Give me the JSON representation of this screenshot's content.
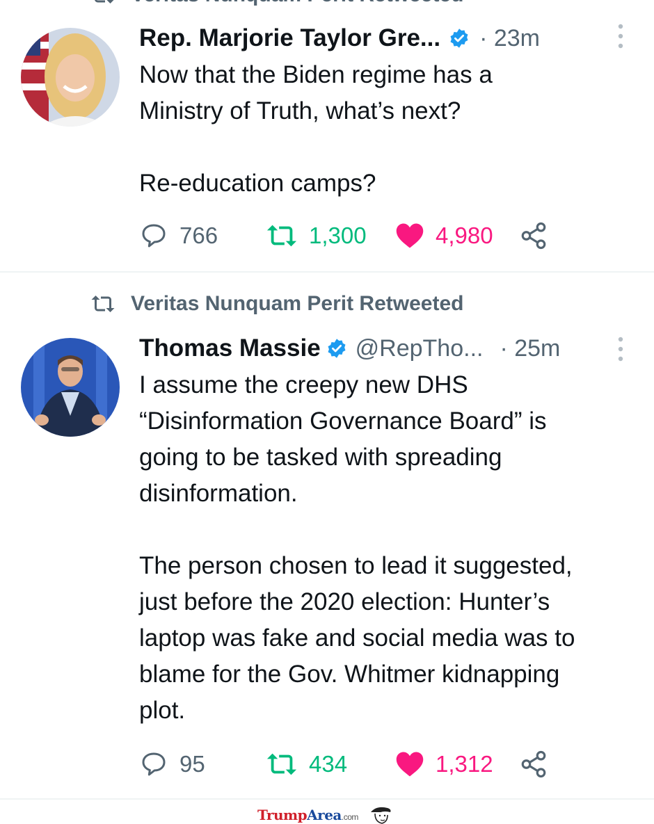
{
  "top_retweet_label": "Veritas Nunquam Perit Retweeted",
  "tweets": [
    {
      "author_name": "Rep. Marjorie Taylor Gre...",
      "handle": "",
      "time": "· 23m",
      "text": "Now that the Biden regime has a\nMinistry of Truth, what’s next?\n\nRe-education camps?",
      "replies": "766",
      "retweets": "1,300",
      "likes": "4,980",
      "liked": true
    },
    {
      "retweeted_by": "Veritas Nunquam Perit Retweeted",
      "author_name": "Thomas Massie",
      "handle": "@RepTho...",
      "time": "· 25m",
      "text": "I assume the creepy new DHS\n“Disinformation Governance Board” is\ngoing to be tasked with spreading\ndisinformation.\n\nThe person chosen to lead it suggested,\njust before the 2020 election: Hunter’s\nlaptop was fake and social media was to\nblame for the Gov. Whitmer kidnapping\nplot.",
      "replies": "95",
      "retweets": "434",
      "likes": "1,312",
      "liked": true
    }
  ],
  "watermark": {
    "part1": "Trump",
    "part2": "Area",
    "part3": ".com"
  },
  "colors": {
    "verified": "#1d9bf0",
    "retweet_green": "#00ba7c",
    "like_pink": "#f91880",
    "secondary_text": "#536471"
  }
}
